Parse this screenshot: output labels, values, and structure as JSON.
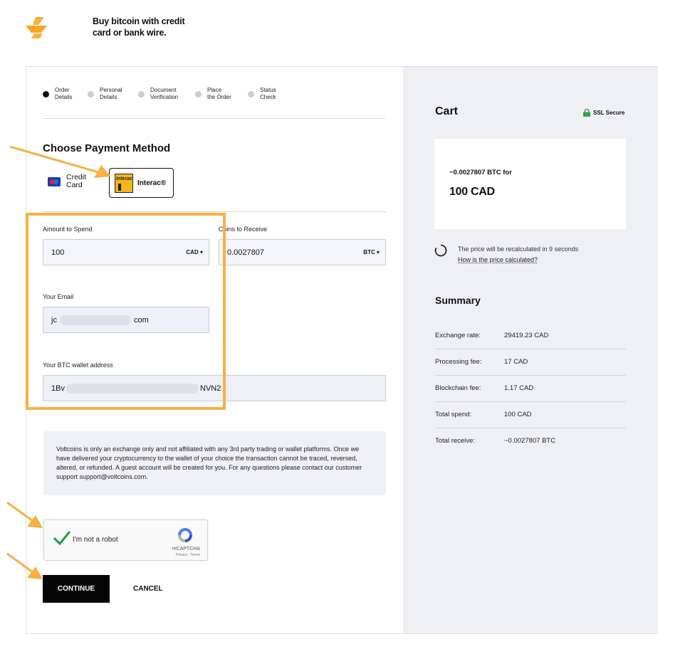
{
  "brand": {
    "logo_icon": "voltcoins-logo-icon",
    "tagline": "Buy bitcoin with credit card or bank wire.",
    "accent": "#f7b043"
  },
  "steps": [
    {
      "label": "Order\nDetails",
      "active": true
    },
    {
      "label": "Personal\nDetails",
      "active": false
    },
    {
      "label": "Document\nVerification",
      "active": false
    },
    {
      "label": "Place\nthe Order",
      "active": false
    },
    {
      "label": "Status\nCheck",
      "active": false
    }
  ],
  "payment": {
    "title": "Choose Payment Method",
    "credit_card_label": "Credit\nCard",
    "interac_label": "Interac®",
    "interac_logo_text": "Interac"
  },
  "form": {
    "amount_label": "Amount to Spend",
    "amount_value": "100",
    "amount_currency": "CAD",
    "receive_label": "Coins to Receive",
    "receive_value": "0.0027807",
    "receive_currency": "BTC",
    "email_label": "Your Email",
    "email_prefix": "jc",
    "email_suffix": "com",
    "wallet_label": "Your BTC wallet address",
    "wallet_prefix": "1Bv",
    "wallet_suffix": "NVN2"
  },
  "notice": "Voltcoins is only an exchange only and not affiliated with any 3rd party trading or wallet platforms. Once we have delivered your cryptocurrency to the wallet of your choice the transaction cannot be traced, reversed, altered, or refunded. A guest account will be created for you. For any questions please contact our customer support support@voltcoins.com.",
  "recaptcha": {
    "label": "I'm not a robot",
    "brand": "reCAPTCHA",
    "terms": "Privacy - Terms"
  },
  "actions": {
    "continue": "CONTINUE",
    "cancel": "CANCEL"
  },
  "cart": {
    "title": "Cart",
    "ssl": "SSL Secure",
    "btc_line": "~0.0027807 BTC for",
    "cad_line": "100 CAD",
    "recalc_text": "The price will be recalculated in 9 seconds",
    "recalc_link": "How is the price calculated?"
  },
  "summary": {
    "title": "Summary",
    "rows": [
      {
        "key": "Exchange rate:",
        "value": "29419.23 CAD"
      },
      {
        "key": "Processing fee:",
        "value": "17 CAD"
      },
      {
        "key": "Blockchain fee:",
        "value": "1.17 CAD"
      },
      {
        "key": "Total spend:",
        "value": "100 CAD"
      },
      {
        "key": "Total receive:",
        "value": "~0.0027807 BTC"
      }
    ]
  }
}
